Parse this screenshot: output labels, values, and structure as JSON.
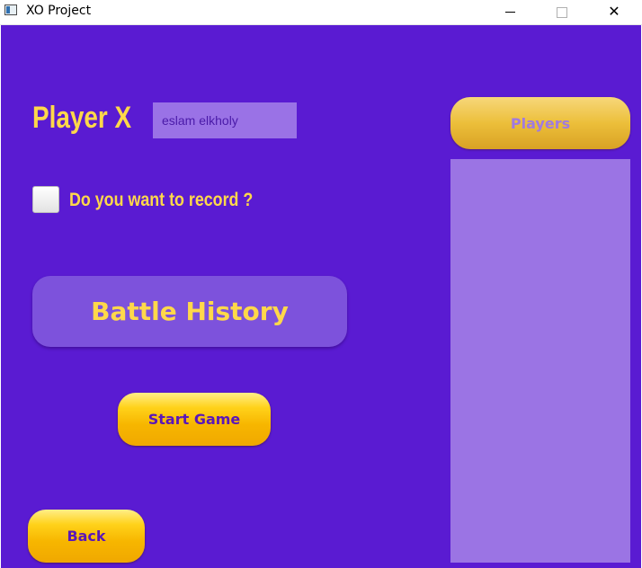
{
  "window": {
    "title": "XO Project",
    "minimize_symbol": "",
    "maximize_symbol": "",
    "close_symbol": "✕"
  },
  "colors": {
    "background": "#5a1bd2",
    "accent_yellow": "#ffd84a",
    "panel_purple": "#9b74e4",
    "button_gold": "#f7b600",
    "button_text": "#5a17b8"
  },
  "player": {
    "label": "Player X",
    "name_value": "eslam elkholy"
  },
  "record": {
    "checked": false,
    "label": "Do you want to record ?"
  },
  "buttons": {
    "battle_history": "Battle History",
    "start_game": "Start Game",
    "back": "Back",
    "players": "Players"
  },
  "players_list": {
    "items": []
  }
}
